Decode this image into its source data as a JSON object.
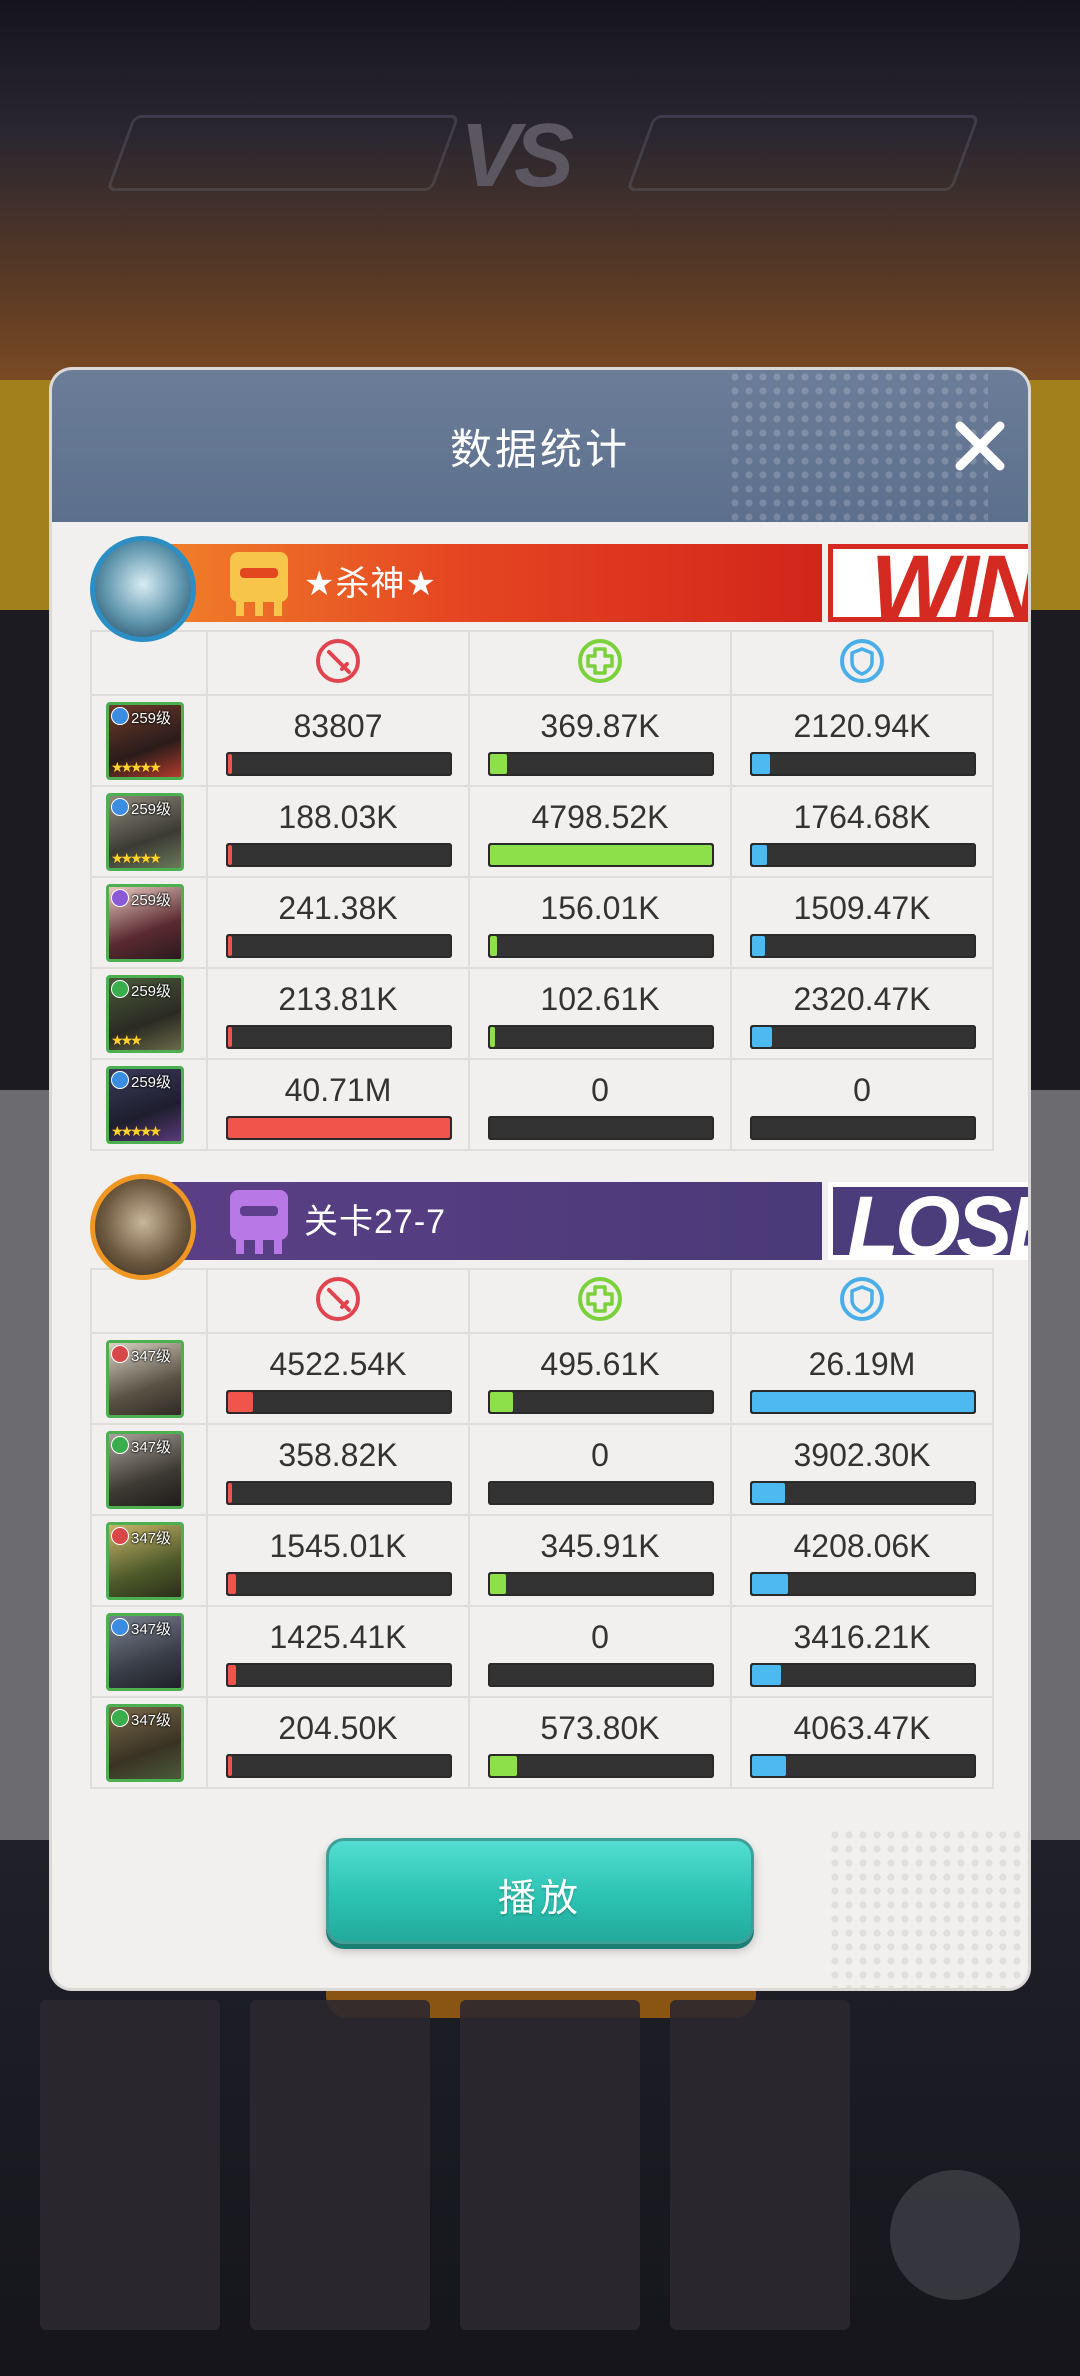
{
  "dialog": {
    "title": "数据统计",
    "play_label": "播放"
  },
  "stat_icons": {
    "damage": "sword-icon",
    "heal": "heal-plus-icon",
    "tank": "shield-icon"
  },
  "colors": {
    "damage": "#f0544a",
    "heal": "#8ee04a",
    "tank": "#4cbaf1",
    "win": "#d52a21",
    "lose": "#4b3c7c"
  },
  "teams": [
    {
      "name": "★杀神★",
      "result": "WIN",
      "heroes": [
        {
          "level": "259级",
          "stars": "★★★★★",
          "damage": "83807",
          "heal": "369.87K",
          "tank": "2120.94K",
          "damage_ratio": 0.002,
          "heal_ratio": 0.077,
          "tank_ratio": 0.081
        },
        {
          "level": "259级",
          "stars": "★★★★★",
          "damage": "188.03K",
          "heal": "4798.52K",
          "tank": "1764.68K",
          "damage_ratio": 0.005,
          "heal_ratio": 1.0,
          "tank_ratio": 0.067
        },
        {
          "level": "259级",
          "stars": "",
          "damage": "241.38K",
          "heal": "156.01K",
          "tank": "1509.47K",
          "damage_ratio": 0.006,
          "heal_ratio": 0.033,
          "tank_ratio": 0.058
        },
        {
          "level": "259级",
          "stars": "★★★",
          "damage": "213.81K",
          "heal": "102.61K",
          "tank": "2320.47K",
          "damage_ratio": 0.005,
          "heal_ratio": 0.021,
          "tank_ratio": 0.089
        },
        {
          "level": "259级",
          "stars": "★★★★★",
          "damage": "40.71M",
          "heal": "0",
          "tank": "0",
          "damage_ratio": 1.0,
          "heal_ratio": 0,
          "tank_ratio": 0
        }
      ]
    },
    {
      "name": "关卡27-7",
      "result": "LOSE",
      "heroes": [
        {
          "level": "347级",
          "stars": "",
          "damage": "4522.54K",
          "heal": "495.61K",
          "tank": "26.19M",
          "damage_ratio": 0.111,
          "heal_ratio": 0.103,
          "tank_ratio": 1.0
        },
        {
          "level": "347级",
          "stars": "",
          "damage": "358.82K",
          "heal": "0",
          "tank": "3902.30K",
          "damage_ratio": 0.009,
          "heal_ratio": 0,
          "tank_ratio": 0.149
        },
        {
          "level": "347级",
          "stars": "",
          "damage": "1545.01K",
          "heal": "345.91K",
          "tank": "4208.06K",
          "damage_ratio": 0.038,
          "heal_ratio": 0.072,
          "tank_ratio": 0.161
        },
        {
          "level": "347级",
          "stars": "",
          "damage": "1425.41K",
          "heal": "0",
          "tank": "3416.21K",
          "damage_ratio": 0.035,
          "heal_ratio": 0,
          "tank_ratio": 0.13
        },
        {
          "level": "347级",
          "stars": "",
          "damage": "204.50K",
          "heal": "573.80K",
          "tank": "4063.47K",
          "damage_ratio": 0.005,
          "heal_ratio": 0.12,
          "tank_ratio": 0.155
        }
      ]
    }
  ]
}
